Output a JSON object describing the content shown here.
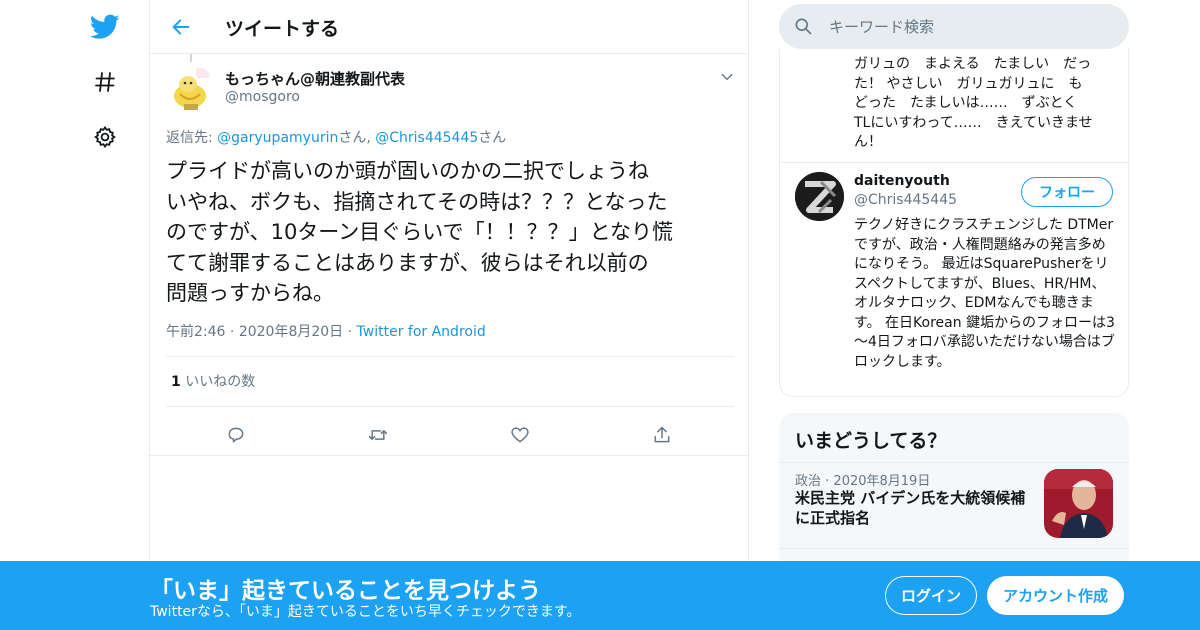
{
  "colors": {
    "brand": "#1da1f2",
    "link": "#1b95e0",
    "muted": "#657786",
    "border": "#e6ecf0"
  },
  "nav": {
    "logo_icon": "twitter-bird-icon",
    "explore_icon": "hashtag-icon",
    "settings_icon": "gear-icon"
  },
  "header": {
    "title": "ツイートする",
    "back_icon": "back-arrow-icon"
  },
  "tweet": {
    "display_name": "もっちゃん@朝連教副代表",
    "handle": "@mosgoro",
    "reply_prefix": "返信先: ",
    "reply_user1": "@garyupamyurin",
    "reply_sep1": "さん, ",
    "reply_user2": "@Chris445445",
    "reply_sep2": "さん",
    "text": "プライドが高いのか頭が固いのかの二択でしょうね\nいやね、ボクも、指摘されてその時は？？？となった\nのですが、10ターン目ぐらいで「！！？？」となり慌\nてて謝罪することはありますが、彼らはそれ以前の\n問題っすからね。",
    "time": "午前2:46",
    "dot1": " · ",
    "date": "2020年8月20日",
    "dot2": " · ",
    "source": "Twitter for Android",
    "like_count": "1",
    "like_label": " いいねの数",
    "actions": [
      "reply-icon",
      "retweet-icon",
      "like-icon",
      "share-icon"
    ]
  },
  "search": {
    "placeholder": "キーワード検索"
  },
  "user_card": {
    "bio_preview": "ガリュの　まよえる　たましい　だっ\nた！ やさしい　ガリュガリュに　も\nどった　たましいは……　ずぶとく\nTLにいすわって……　きえていきませ\nん！",
    "name": "daitenyouth",
    "handle": "@Chris445445",
    "follow_label": "フォロー",
    "bio": "テクノ好きにクラスチェンジした DTMerですが、政治・人権問題絡みの発言多めになりそう。 最近はSquarePusherをリスペクトしてますが、Blues、HR/HM、オルタナロック、EDMなんでも聴きます。 在日Korean 鍵垢からのフォローは3～4日フォロバ承認いただけない場合はブロックします。"
  },
  "trends": {
    "title": "いまどうしてる？",
    "item": {
      "category": "政治",
      "dot": " · ",
      "date": "2020年8月19日",
      "title": "米民主党 バイデン氏を大統領候補に正式指名"
    }
  },
  "bottom_bar": {
    "title": "「いま」起きていることを見つけよう",
    "subtitle": "Twitterなら、「いま」起きていることをいち早くチェックできます。",
    "login": "ログイン",
    "signup": "アカウント作成"
  }
}
